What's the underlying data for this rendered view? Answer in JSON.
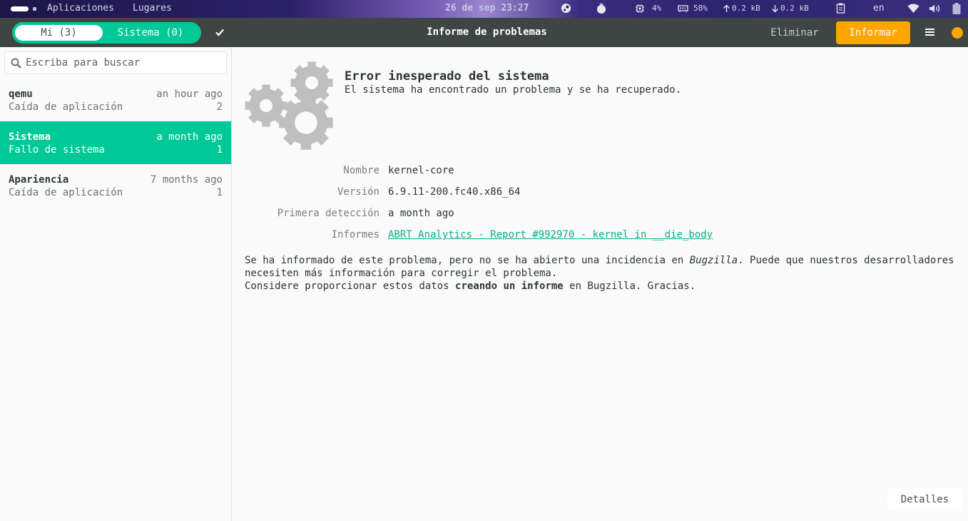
{
  "top_panel": {
    "apps_label": "Aplicaciones",
    "places_label": "Lugares",
    "clock": "26 de sep 23:27",
    "cpu": "4%",
    "memory": "58%",
    "net_up": "0.2 kB",
    "net_down": "0.2 kB",
    "keyboard_layout": "en",
    "icons": [
      "steam-icon",
      "fedora-icon",
      "cpu-icon",
      "memory-icon",
      "arrow-up-icon",
      "arrow-down-icon",
      "clipboard-icon",
      "wifi-icon",
      "volume-icon",
      "battery-icon"
    ]
  },
  "header": {
    "tab_mine": "Mi (3)",
    "tab_system": "Sistema (0)",
    "title": "Informe de problemas",
    "delete_label": "Eliminar",
    "report_label": "Informar",
    "accent": "#00c896",
    "report_color": "#ffa500"
  },
  "sidebar": {
    "search_placeholder": "Escriba para buscar",
    "items": [
      {
        "name": "qemu",
        "time": "an hour ago",
        "type": "Caída de aplicación",
        "count": "2",
        "selected": false
      },
      {
        "name": "Sistema",
        "time": "a month ago",
        "type": "Fallo de sistema",
        "count": "1",
        "selected": true
      },
      {
        "name": "Apariencia",
        "time": "7 months ago",
        "type": "Caída de aplicación",
        "count": "1",
        "selected": false
      }
    ]
  },
  "problem": {
    "title": "Error inesperado del sistema",
    "subtitle": "El sistema ha encontrado un problema y se ha recuperado.",
    "fields": [
      {
        "label": "Nombre",
        "value": "kernel-core"
      },
      {
        "label": "Versión",
        "value": "6.9.11-200.fc40.x86_64"
      },
      {
        "label": "Primera detección",
        "value": "a month ago"
      },
      {
        "label": "Informes",
        "value": "ABRT Analytics - Report #992970 - kernel in __die_body"
      }
    ],
    "note_part1": "Se ha informado de este problema, pero no se ha abierto una incidencia en ",
    "note_bugzilla": "Bugzilla",
    "note_part2": ". Puede que nuestros desarrolladores necesiten más información para corregir el problema.",
    "note_part3": "Considere proporcionar estos datos ",
    "note_bold": "creando un informe",
    "note_part4": " en Bugzilla. Gracias.",
    "details_label": "Detalles"
  }
}
